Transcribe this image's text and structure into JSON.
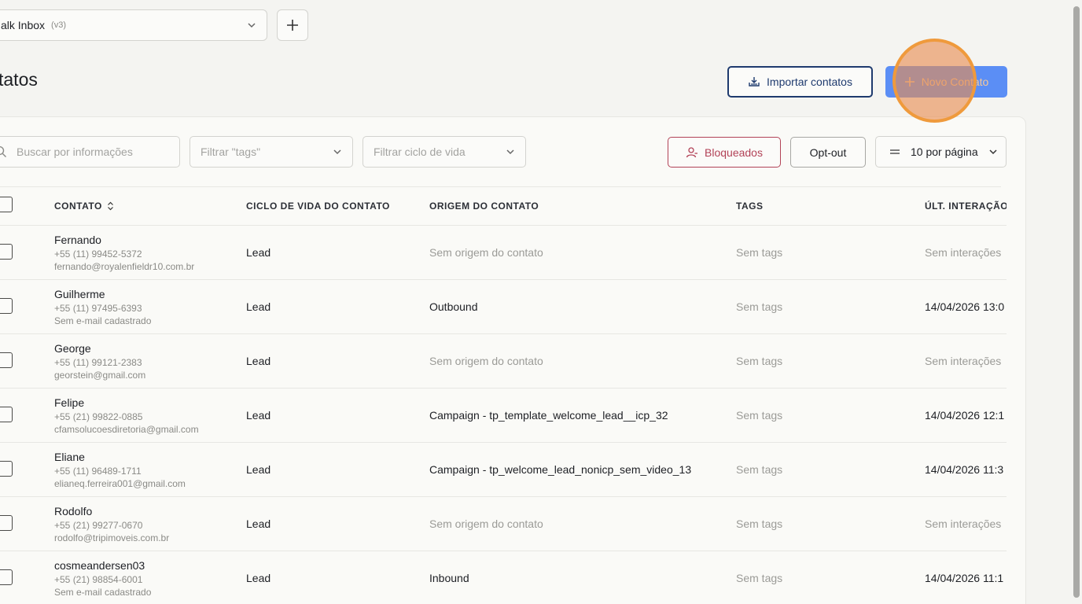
{
  "header": {
    "inbox_name": "alk Inbox",
    "inbox_version": "(v3)",
    "page_title": "tatos",
    "import_label": "Importar contatos",
    "new_contact_label": "Novo Contato"
  },
  "filters": {
    "search_placeholder": "Buscar por informações",
    "tags_placeholder": "Filtrar \"tags\"",
    "cycle_placeholder": "Filtrar ciclo de vida",
    "blocked_label": "Bloqueados",
    "optout_label": "Opt-out",
    "per_page_label": "10 por página"
  },
  "table": {
    "columns": {
      "contact": "CONTATO",
      "cycle": "CICLO DE VIDA DO CONTATO",
      "origin": "ORIGEM DO CONTATO",
      "tags": "TAGS",
      "last": "ÚLT. INTERAÇÃO"
    },
    "rows": [
      {
        "name": "Fernando",
        "phone": "+55 (11) 99452-5372",
        "email": "fernando@royalenfieldr10.com.br",
        "cycle": "Lead",
        "origin": "Sem origem do contato",
        "tags": "Sem tags",
        "last": "Sem interações"
      },
      {
        "name": "Guilherme",
        "phone": "+55 (11) 97495-6393",
        "email": "Sem e-mail cadastrado",
        "cycle": "Lead",
        "origin": "Outbound",
        "tags": "Sem tags",
        "last": "14/04/2026 13:0"
      },
      {
        "name": "George",
        "phone": "+55 (11) 99121-2383",
        "email": "georstein@gmail.com",
        "cycle": "Lead",
        "origin": "Sem origem do contato",
        "tags": "Sem tags",
        "last": "Sem interações"
      },
      {
        "name": "Felipe",
        "phone": "+55 (21) 99822-0885",
        "email": "cfamsolucoesdiretoria@gmail.com",
        "cycle": "Lead",
        "origin": "Campaign - tp_template_welcome_lead__icp_32",
        "tags": "Sem tags",
        "last": "14/04/2026 12:1"
      },
      {
        "name": "Eliane",
        "phone": "+55 (11) 96489-1711",
        "email": "elianeq.ferreira001@gmail.com",
        "cycle": "Lead",
        "origin": "Campaign - tp_welcome_lead_nonicp_sem_video_13",
        "tags": "Sem tags",
        "last": "14/04/2026 11:3"
      },
      {
        "name": "Rodolfo",
        "phone": "+55 (21) 99277-0670",
        "email": "rodolfo@tripimoveis.com.br",
        "cycle": "Lead",
        "origin": "Sem origem do contato",
        "tags": "Sem tags",
        "last": "Sem interações"
      },
      {
        "name": "cosmeandersen03",
        "phone": "+55 (21) 98854-6001",
        "email": "Sem e-mail cadastrado",
        "cycle": "Lead",
        "origin": "Inbound",
        "tags": "Sem tags",
        "last": "14/04/2026 11:1"
      }
    ]
  },
  "colors": {
    "primary": "#5b8ef5",
    "navy": "#1e3a6e",
    "danger": "#b24257",
    "highlight": "#ef9a3c"
  }
}
